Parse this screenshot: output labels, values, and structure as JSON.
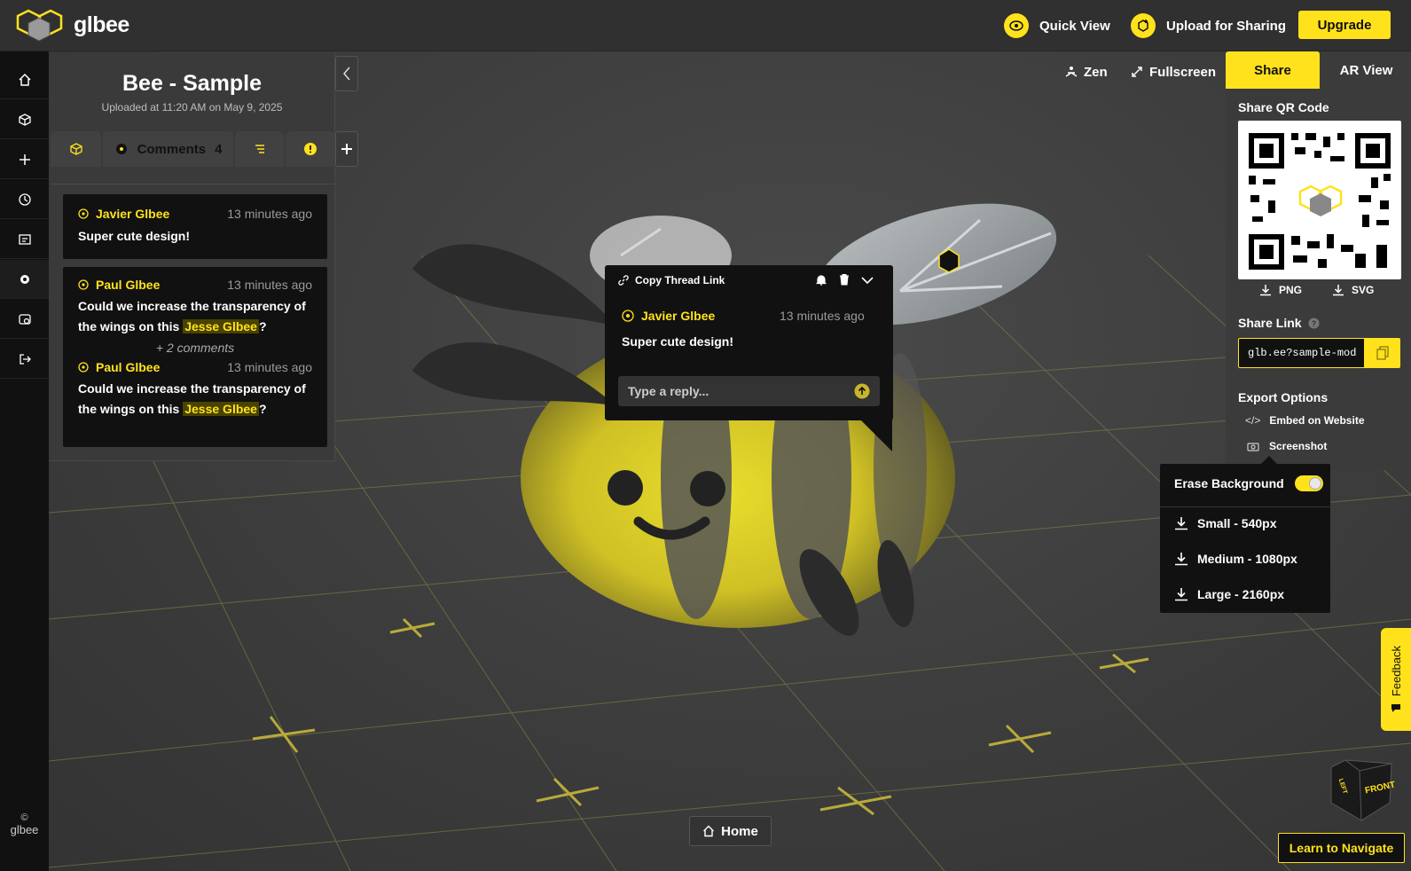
{
  "header": {
    "logo_text": "glbee",
    "quick_view": "Quick View",
    "upload": "Upload for Sharing",
    "upgrade": "Upgrade"
  },
  "sidebar": {
    "footer": "glbee",
    "items": [
      "home-icon",
      "cube-icon",
      "plus-icon",
      "history-icon",
      "feedback-board-icon",
      "gear-icon",
      "preview-icon",
      "logout-icon"
    ]
  },
  "panel": {
    "title": "Bee - Sample",
    "subtitle": "Uploaded at 11:20 AM on May 9, 2025",
    "tabs": {
      "comments_label": "Comments",
      "comments_count": "4"
    }
  },
  "comments": [
    {
      "author": "Javier Glbee",
      "time": "13 minutes ago",
      "text": "Super cute design!"
    },
    {
      "author": "Paul Glbee",
      "time": "13 minutes ago",
      "text_before": "Could we increase the transparency of the wings on this ",
      "mention": "Jesse Glbee",
      "text_after": "?",
      "more": "+ 2 comments",
      "reply": {
        "author": "Paul Glbee",
        "time": "13 minutes ago",
        "text_before": "Could we increase the transparency of the wings on this ",
        "mention": "Jesse Glbee",
        "text_after": "?"
      }
    }
  ],
  "thread_popup": {
    "copy_link": "Copy Thread Link",
    "author": "Javier Glbee",
    "time": "13 minutes ago",
    "text": "Super cute design!",
    "reply_placeholder": "Type a reply..."
  },
  "viewer_controls": {
    "zen": "Zen",
    "fullscreen": "Fullscreen",
    "tab_share": "Share",
    "tab_ar": "AR View",
    "home": "Home",
    "learn": "Learn to Navigate",
    "feedback": "Feedback",
    "nav_cube": {
      "front": "FRONT",
      "left": "LEFT"
    }
  },
  "share_panel": {
    "qr_title": "Share QR Code",
    "png": "PNG",
    "svg": "SVG",
    "link_title": "Share Link",
    "link_value": "glb.ee?sample-mod",
    "export_title": "Export Options",
    "embed": "Embed on Website",
    "screenshot": "Screenshot"
  },
  "screenshot_menu": {
    "erase_bg": "Erase Background",
    "erase_bg_on": true,
    "options": [
      "Small - 540px",
      "Medium - 1080px",
      "Large - 2160px"
    ]
  },
  "colors": {
    "accent": "#ffe21c",
    "topbar": "#303030",
    "sidebar": "#111111",
    "viewport": "#3d3d3d"
  }
}
